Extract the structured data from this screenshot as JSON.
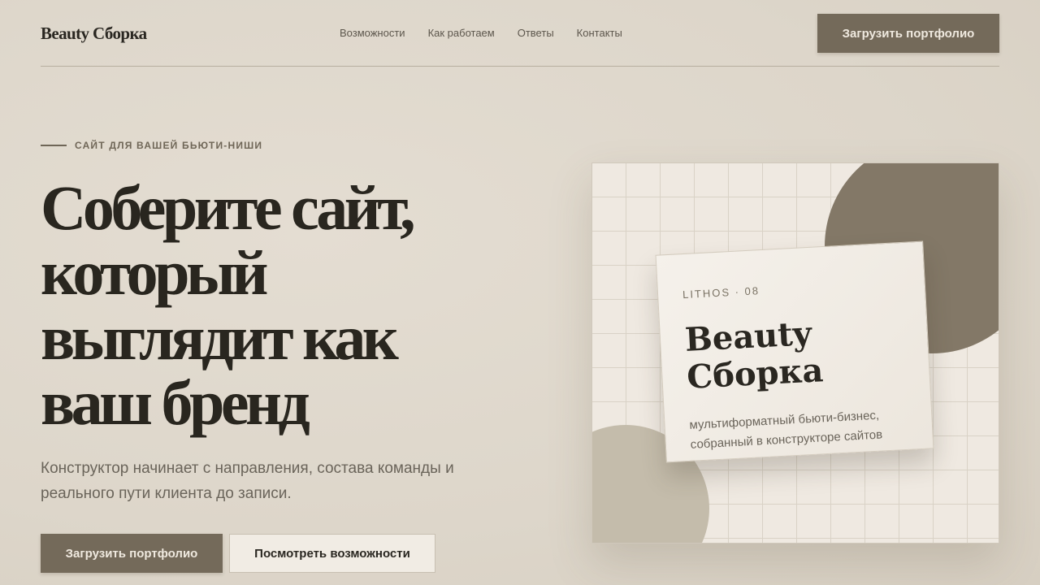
{
  "header": {
    "logo": "Beauty Сборка",
    "nav": [
      "Возможности",
      "Как работаем",
      "Ответы",
      "Контакты"
    ],
    "cta_label": "Загрузить портфолио"
  },
  "hero": {
    "eyebrow": "САЙТ ДЛЯ ВАШЕЙ БЬЮТИ-НИШИ",
    "title_lines": [
      "Соберите сайт,",
      "который",
      "выглядит как",
      "ваш бренд"
    ],
    "subtitle": "Конструктор начинает с направления, состава команды и реального пути клиента до записи.",
    "primary_label": "Загрузить портфолио",
    "secondary_label": "Посмотреть возможности"
  },
  "preview_card": {
    "kicker": "LITHOS · 08",
    "title_lines": [
      "Beauty",
      "Сборка"
    ],
    "description": "мультиформатный бьюти-бизнес, собранный в конструкторе сайтов"
  },
  "colors": {
    "background": "#ddd6ca",
    "accent_button": "#746a5a",
    "text_dark": "#29261f",
    "circle_dark": "#837867",
    "circle_light": "#c4bcab"
  }
}
